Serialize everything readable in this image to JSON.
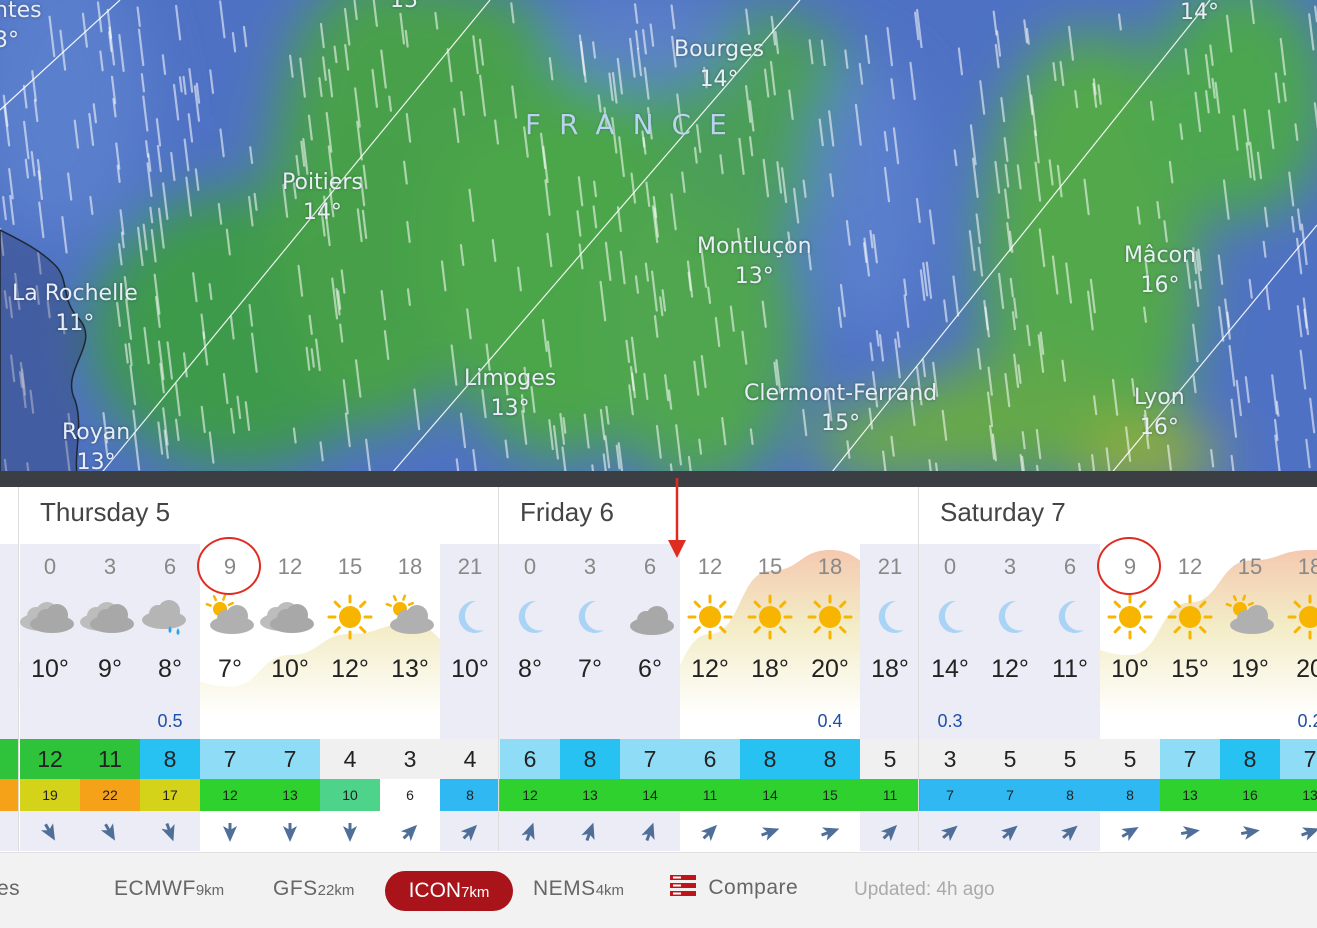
{
  "map": {
    "country": "FRANCE",
    "cities": [
      {
        "name": "Poitiers",
        "temp": "14°"
      },
      {
        "name": "Bourges",
        "temp": "14°"
      },
      {
        "name": "Montluçon",
        "temp": "13°"
      },
      {
        "name": "Mâcon",
        "temp": "16°"
      },
      {
        "name": "La Rochelle",
        "temp": "11°"
      },
      {
        "name": "Limoges",
        "temp": "13°"
      },
      {
        "name": "Clermont-Ferrand",
        "temp": "15°"
      },
      {
        "name": "Lyon",
        "temp": "16°"
      },
      {
        "name": "Royan",
        "temp": "13°"
      },
      {
        "name": "ntes",
        "temp": "3°"
      },
      {
        "name": "",
        "temp": "13"
      },
      {
        "name": "",
        "temp": "14°"
      }
    ]
  },
  "forecast": {
    "partial_left": {
      "temp": "°"
    },
    "days": [
      {
        "label": "Thursday 5"
      },
      {
        "label": "Friday 6"
      },
      {
        "label": "Saturday 7"
      }
    ],
    "slots": [
      {
        "hour": "0",
        "temp": "10°",
        "precip": "",
        "wind": "12",
        "gust": "19",
        "icon": "cloudy-icon",
        "dir": "wind-direction-icon"
      },
      {
        "hour": "3",
        "temp": "9°",
        "precip": "",
        "wind": "11",
        "gust": "22",
        "icon": "cloudy-icon",
        "dir": "wind-direction-icon"
      },
      {
        "hour": "6",
        "temp": "8°",
        "precip": "0.5",
        "wind": "8",
        "gust": "17",
        "icon": "rain-cloud-icon",
        "dir": "wind-direction-icon"
      },
      {
        "hour": "9",
        "temp": "7°",
        "precip": "",
        "wind": "7",
        "gust": "12",
        "icon": "partly-cloudy-icon",
        "dir": "wind-direction-icon"
      },
      {
        "hour": "12",
        "temp": "10°",
        "precip": "",
        "wind": "7",
        "gust": "13",
        "icon": "cloudy-icon",
        "dir": "wind-direction-icon"
      },
      {
        "hour": "15",
        "temp": "12°",
        "precip": "",
        "wind": "4",
        "gust": "10",
        "icon": "sun-icon",
        "dir": "wind-direction-icon"
      },
      {
        "hour": "18",
        "temp": "13°",
        "precip": "",
        "wind": "3",
        "gust": "6",
        "icon": "partly-cloudy-icon",
        "dir": "wind-direction-icon"
      },
      {
        "hour": "21",
        "temp": "10°",
        "precip": "",
        "wind": "4",
        "gust": "8",
        "icon": "moon-icon",
        "dir": "wind-direction-icon"
      },
      {
        "hour": "0",
        "temp": "8°",
        "precip": "",
        "wind": "6",
        "gust": "12",
        "icon": "moon-icon",
        "dir": "wind-direction-icon"
      },
      {
        "hour": "3",
        "temp": "7°",
        "precip": "",
        "wind": "8",
        "gust": "13",
        "icon": "moon-icon",
        "dir": "wind-direction-icon"
      },
      {
        "hour": "6",
        "temp": "6°",
        "precip": "",
        "wind": "7",
        "gust": "14",
        "icon": "moon-cloud-icon",
        "dir": "wind-direction-icon"
      },
      {
        "hour": "12",
        "temp": "12°",
        "precip": "",
        "wind": "6",
        "gust": "11",
        "icon": "sun-icon",
        "dir": "wind-direction-icon"
      },
      {
        "hour": "15",
        "temp": "18°",
        "precip": "",
        "wind": "8",
        "gust": "14",
        "icon": "sun-icon",
        "dir": "wind-direction-icon"
      },
      {
        "hour": "18",
        "temp": "20°",
        "precip": "0.4",
        "wind": "8",
        "gust": "15",
        "icon": "sun-icon",
        "dir": "wind-direction-icon"
      },
      {
        "hour": "21",
        "temp": "18°",
        "precip": "",
        "wind": "5",
        "gust": "11",
        "icon": "moon-icon",
        "dir": "wind-direction-icon"
      },
      {
        "hour": "0",
        "temp": "14°",
        "precip": "0.3",
        "wind": "3",
        "gust": "7",
        "icon": "moon-icon",
        "dir": "wind-direction-icon"
      },
      {
        "hour": "3",
        "temp": "12°",
        "precip": "",
        "wind": "5",
        "gust": "7",
        "icon": "moon-icon",
        "dir": "wind-direction-icon"
      },
      {
        "hour": "6",
        "temp": "11°",
        "precip": "",
        "wind": "5",
        "gust": "8",
        "icon": "moon-icon",
        "dir": "wind-direction-icon"
      },
      {
        "hour": "9",
        "temp": "10°",
        "precip": "",
        "wind": "5",
        "gust": "8",
        "icon": "sun-icon",
        "dir": "wind-direction-icon"
      },
      {
        "hour": "12",
        "temp": "15°",
        "precip": "",
        "wind": "7",
        "gust": "13",
        "icon": "sun-icon",
        "dir": "wind-direction-icon"
      },
      {
        "hour": "15",
        "temp": "19°",
        "precip": "",
        "wind": "8",
        "gust": "16",
        "icon": "partly-cloudy-icon",
        "dir": "wind-direction-icon"
      },
      {
        "hour": "18",
        "temp": "20",
        "precip": "0.2",
        "wind": "7",
        "gust": "13",
        "icon": "sun-icon",
        "dir": "wind-direction-icon"
      }
    ]
  },
  "models": {
    "partial_left": "es",
    "ecmwf": {
      "name": "ECMWF",
      "res": "9km"
    },
    "gfs": {
      "name": "GFS",
      "res": "22km"
    },
    "icon": {
      "name": "ICON",
      "res": "7km"
    },
    "nems": {
      "name": "NEMS",
      "res": "4km"
    },
    "compare": "Compare",
    "updated": "Updated: 4h ago"
  },
  "colors": {
    "accent": "#a8141a",
    "marker": "#e02b20"
  }
}
